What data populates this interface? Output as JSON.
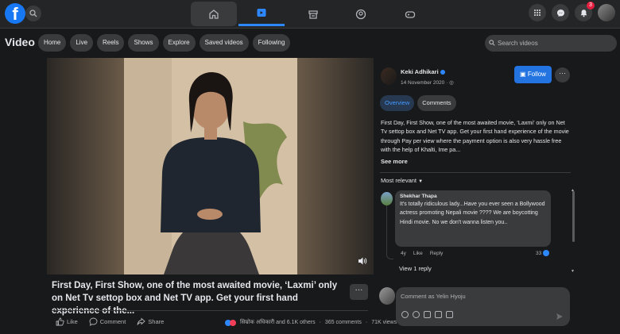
{
  "app": {
    "logo_letter": "f",
    "brand_color": "#1877f2"
  },
  "nav": {
    "tabs": [
      "home",
      "video",
      "marketplace",
      "groups",
      "gaming"
    ]
  },
  "topright": {
    "notifications_count": "3"
  },
  "video_page": {
    "title": "Video",
    "chips": [
      "Home",
      "Live",
      "Reels",
      "Shows",
      "Explore",
      "Saved videos",
      "Following"
    ],
    "search_placeholder": "Search videos"
  },
  "post": {
    "caption": "First Day, First Show, one of the most awaited movie, ‘Laxmi’ only on Net Tv settop box and Net TV app. Get your first hand experience of the...",
    "more": "···",
    "actions": {
      "like": "Like",
      "comment": "Comment",
      "share": "Share"
    },
    "reactions_text": "सिम्रोक अधिकारी and 6.1K others",
    "comments_count": "365 comments",
    "views": "71K views"
  },
  "panel": {
    "author": "Keki Adhikari",
    "date": "14 November 2020 · ",
    "follow": "Follow",
    "more": "···",
    "tabs": [
      "Overview",
      "Comments"
    ],
    "description": "First Day, First Show, one of the most awaited movie, ‘Laxmi’ only on Net Tv settop box and Net TV app. Get your first hand experience of the movie through Pay per view where the payment option is also very hassle free with the help of Khalti, Ime pa...",
    "see_more": "See more",
    "sort": "Most relevant",
    "comment": {
      "name": "Shekhar Thapa",
      "text": "It's totally ridiculous lady...Have you ever seen a Bollywood actress promoting Nepali movie ???? We are boycotting Hindi movie. No we don't wanna listen you..",
      "age": "4y",
      "like": "Like",
      "reply": "Reply",
      "likes": "33"
    },
    "view_replies": "View 1 reply",
    "comment_placeholder": "Comment as Yelin Hyoju"
  }
}
